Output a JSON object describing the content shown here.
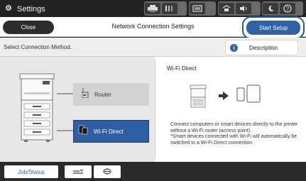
{
  "topbar": {
    "title": "Settings",
    "icons": [
      "printer-icon",
      "ink-levels-icon",
      "maintenance-box-icon",
      "network-icon",
      "sound-icon",
      "eco-icon",
      "sleep-icon",
      "help-icon"
    ]
  },
  "header": {
    "close_label": "Close",
    "title": "Network Connection Settings",
    "start_setup_label": "Start Setup"
  },
  "method_bar": {
    "label": "Select Connection Method.",
    "description_label": "Description"
  },
  "options": {
    "router_label": "Router",
    "wifi_direct_label": "Wi-Fi Direct",
    "selected": "wifi_direct"
  },
  "details": {
    "title": "Wi-Fi Direct",
    "description": "Connect computers or smart devices directly to the printer without a Wi-Fi router (access point).\n*Smart devices connected with Wi-Fi will automatically be switched to a Wi-Fi Direct connection."
  },
  "bottombar": {
    "job_status_label": "Job/Status",
    "date_text": ""
  },
  "colors": {
    "accent": "#2f62a6",
    "topbar": "#232323",
    "close_button": "#2d2d2d"
  }
}
